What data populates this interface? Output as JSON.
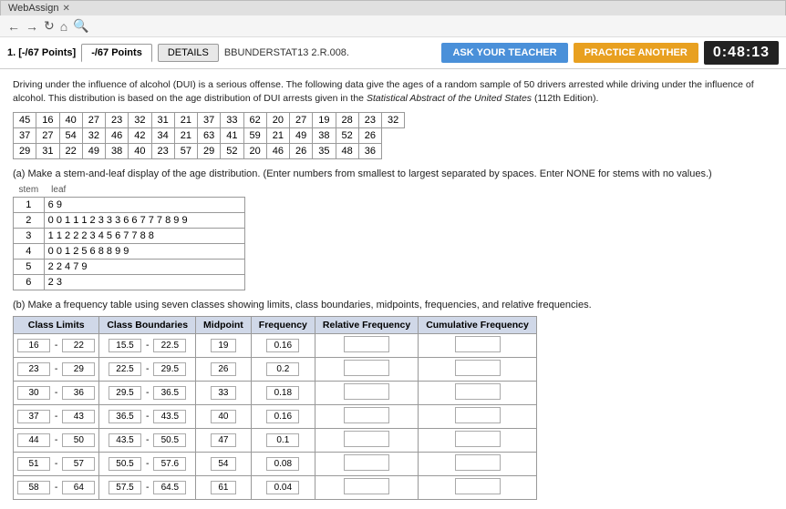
{
  "browser": {
    "tab": "WebAssign",
    "nav_back": "←",
    "nav_forward": "→",
    "nav_refresh": "↻",
    "nav_home": "⌂",
    "nav_search": "🔍"
  },
  "header": {
    "problem_label": "1. [-/67 Points]",
    "tab_points": "-/67 Points",
    "tab_details": "DETAILS",
    "tab_bbunder": "BBUNDERSTAT13 2.R.008.",
    "ask_teacher": "ASK YOUR TEACHER",
    "practice": "PRACTICE ANOTHER",
    "timer": "0:48:13"
  },
  "description": "Driving under the influence of alcohol (DUI) is a serious offense. The following data give the ages of a random sample of 50 drivers arrested while driving under the influence of alcohol. This distribution is based on the age distribution of DUI arrests given in the Statistical Abstract of the United States (112th Edition).",
  "data_rows": [
    [
      45,
      16,
      40,
      27,
      23,
      32,
      31,
      21,
      37,
      33,
      62,
      20,
      27,
      19,
      28,
      23,
      32
    ],
    [
      37,
      27,
      54,
      32,
      46,
      42,
      34,
      21,
      63,
      41,
      59,
      21,
      49,
      38,
      52,
      26
    ],
    [
      29,
      31,
      22,
      49,
      38,
      40,
      23,
      57,
      29,
      52,
      20,
      46,
      26,
      35,
      48,
      36
    ]
  ],
  "part_a_label": "(a) Make a stem-and-leaf display of the age distribution. (Enter numbers from smallest to largest separated by spaces. Enter NONE for stems with no values.)",
  "stem_label": "stem",
  "leaf_label": "leaf",
  "stem_leaves": [
    {
      "stem": "1",
      "leaf": "6 9"
    },
    {
      "stem": "2",
      "leaf": "0 0 1 1 1 2 3 3 3 6 6 7 7 7 8 9 9"
    },
    {
      "stem": "3",
      "leaf": "1 1 2 2 2 3 4 5 6 7 7 8 8"
    },
    {
      "stem": "4",
      "leaf": "0 0 1 2 5 6 8 8 9 9"
    },
    {
      "stem": "5",
      "leaf": "2 2 4 7 9"
    },
    {
      "stem": "6",
      "leaf": "2 3"
    }
  ],
  "part_b_label": "(b) Make a frequency table using seven classes showing limits, class boundaries, midpoints, frequencies, and relative frequencies.",
  "freq_table": {
    "headers": [
      "Class Limits",
      "Class Boundaries",
      "Midpoint",
      "Frequency",
      "Relative Frequency",
      "Cumulative Frequency"
    ],
    "rows": [
      {
        "cl_low": "16",
        "cl_high": "22",
        "cb_low": "15.5",
        "cb_high": "22.5",
        "midpoint": "19",
        "frequency": "0.16",
        "rel_freq": "",
        "cum_freq": ""
      },
      {
        "cl_low": "23",
        "cl_high": "29",
        "cb_low": "22.5",
        "cb_high": "29.5",
        "midpoint": "26",
        "frequency": "0.2",
        "rel_freq": "",
        "cum_freq": ""
      },
      {
        "cl_low": "30",
        "cl_high": "36",
        "cb_low": "29.5",
        "cb_high": "36.5",
        "midpoint": "33",
        "frequency": "0.18",
        "rel_freq": "",
        "cum_freq": ""
      },
      {
        "cl_low": "37",
        "cl_high": "43",
        "cb_low": "36.5",
        "cb_high": "43.5",
        "midpoint": "40",
        "frequency": "0.16",
        "rel_freq": "",
        "cum_freq": ""
      },
      {
        "cl_low": "44",
        "cl_high": "50",
        "cb_low": "43.5",
        "cb_high": "50.5",
        "midpoint": "47",
        "frequency": "0.1",
        "rel_freq": "",
        "cum_freq": ""
      },
      {
        "cl_low": "51",
        "cl_high": "57",
        "cb_low": "50.5",
        "cb_high": "57.6",
        "midpoint": "54",
        "frequency": "0.08",
        "rel_freq": "",
        "cum_freq": ""
      },
      {
        "cl_low": "58",
        "cl_high": "64",
        "cb_low": "57.5",
        "cb_high": "64.5",
        "midpoint": "61",
        "frequency": "0.04",
        "rel_freq": "",
        "cum_freq": ""
      }
    ]
  }
}
